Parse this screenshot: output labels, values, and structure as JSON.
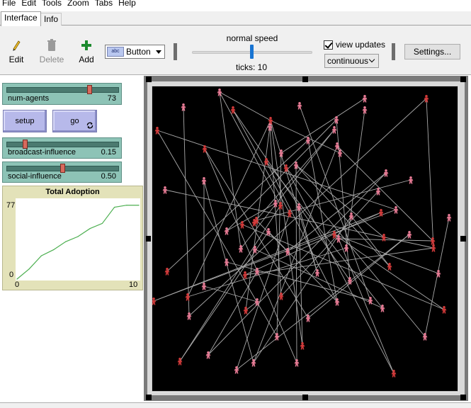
{
  "menu": [
    "File",
    "Edit",
    "Tools",
    "Zoom",
    "Tabs",
    "Help"
  ],
  "tabs": [
    {
      "label": "Interface",
      "active": true
    },
    {
      "label": "Info",
      "active": false
    }
  ],
  "toolbar": {
    "edit_label": "Edit",
    "delete_label": "Delete",
    "add_label": "Add",
    "widget_type": "Button",
    "widget_icon_text": "abc",
    "speed_label": "normal speed",
    "speed": 0.5,
    "ticks_text": "ticks: 10",
    "view_updates_label": "view updates",
    "view_updates_checked": true,
    "update_mode": "continuous",
    "settings_label": "Settings..."
  },
  "widgets": {
    "num_agents": {
      "label": "num-agents",
      "value": "73",
      "fraction": 0.75
    },
    "setup_label": "setup",
    "go_label": "go",
    "broadcast_influence": {
      "label": "broadcast-influence",
      "value": "0.15",
      "fraction": 0.15
    },
    "social_influence": {
      "label": "social-influence",
      "value": "0.50",
      "fraction": 0.5
    }
  },
  "chart_data": {
    "type": "line",
    "title": "Total Adoption",
    "xlabel": "",
    "ylabel": "",
    "xlim": [
      0,
      10
    ],
    "ylim": [
      0,
      77
    ],
    "x_tick_labels": [
      "0",
      "10"
    ],
    "y_tick_labels": [
      "0",
      "77"
    ],
    "series": [
      {
        "color": "#4caf50",
        "x": [
          0,
          1,
          2,
          3,
          4,
          5,
          6,
          7,
          8,
          9,
          10
        ],
        "y": [
          0,
          10,
          23,
          29,
          37,
          42,
          50,
          55,
          71,
          73,
          73
        ]
      }
    ]
  },
  "colors": {
    "slider_bg": "#8dc3b6",
    "button_bg": "#b7b9ea",
    "plot_bg": "#e3e2b9",
    "world_bg": "#000000",
    "adopter_color": "#d43a3a",
    "non_adopter_color": "#e87b95",
    "link_color": "#a9a9a9"
  },
  "agents": [
    {
      "x": 310,
      "y": 130,
      "s": 0
    },
    {
      "x": 259,
      "y": 151,
      "s": 0
    },
    {
      "x": 329,
      "y": 155,
      "s": 1
    },
    {
      "x": 423,
      "y": 149,
      "s": 0
    },
    {
      "x": 515,
      "y": 139,
      "s": 0
    },
    {
      "x": 515,
      "y": 155,
      "s": 0
    },
    {
      "x": 602,
      "y": 139,
      "s": 1
    },
    {
      "x": 382,
      "y": 170,
      "s": 1
    },
    {
      "x": 475,
      "y": 169,
      "s": 0
    },
    {
      "x": 222,
      "y": 184,
      "s": 1
    },
    {
      "x": 381,
      "y": 179,
      "s": 0
    },
    {
      "x": 472,
      "y": 183,
      "s": 0
    },
    {
      "x": 289,
      "y": 210,
      "s": 1
    },
    {
      "x": 435,
      "y": 198,
      "s": 0
    },
    {
      "x": 476,
      "y": 206,
      "s": 0
    },
    {
      "x": 397,
      "y": 216,
      "s": 0
    },
    {
      "x": 480,
      "y": 216,
      "s": 0
    },
    {
      "x": 376,
      "y": 228,
      "s": 1
    },
    {
      "x": 404,
      "y": 237,
      "s": 1
    },
    {
      "x": 418,
      "y": 233,
      "s": 0
    },
    {
      "x": 288,
      "y": 255,
      "s": 0
    },
    {
      "x": 545,
      "y": 244,
      "s": 0
    },
    {
      "x": 580,
      "y": 254,
      "s": 0
    },
    {
      "x": 233,
      "y": 268,
      "s": 0
    },
    {
      "x": 534,
      "y": 270,
      "s": 0
    },
    {
      "x": 389,
      "y": 287,
      "s": 0
    },
    {
      "x": 396,
      "y": 290,
      "s": 1
    },
    {
      "x": 422,
      "y": 292,
      "s": 0
    },
    {
      "x": 409,
      "y": 301,
      "s": 1
    },
    {
      "x": 559,
      "y": 296,
      "s": 0
    },
    {
      "x": 538,
      "y": 300,
      "s": 1
    },
    {
      "x": 496,
      "y": 305,
      "s": 0
    },
    {
      "x": 634,
      "y": 307,
      "s": 0
    },
    {
      "x": 359,
      "y": 314,
      "s": 1
    },
    {
      "x": 342,
      "y": 317,
      "s": 1
    },
    {
      "x": 362,
      "y": 311,
      "s": 1
    },
    {
      "x": 320,
      "y": 326,
      "s": 0
    },
    {
      "x": 379,
      "y": 327,
      "s": 0
    },
    {
      "x": 472,
      "y": 331,
      "s": 1
    },
    {
      "x": 478,
      "y": 337,
      "s": 0
    },
    {
      "x": 578,
      "y": 331,
      "s": 0
    },
    {
      "x": 542,
      "y": 335,
      "s": 1
    },
    {
      "x": 611,
      "y": 340,
      "s": 1
    },
    {
      "x": 612,
      "y": 350,
      "s": 1
    },
    {
      "x": 489,
      "y": 350,
      "s": 0
    },
    {
      "x": 340,
      "y": 351,
      "s": 0
    },
    {
      "x": 360,
      "y": 352,
      "s": 0
    },
    {
      "x": 406,
      "y": 355,
      "s": 0
    },
    {
      "x": 550,
      "y": 376,
      "s": 1
    },
    {
      "x": 320,
      "y": 370,
      "s": 0
    },
    {
      "x": 363,
      "y": 383,
      "s": 0
    },
    {
      "x": 236,
      "y": 383,
      "s": 1
    },
    {
      "x": 346,
      "y": 388,
      "s": 1
    },
    {
      "x": 448,
      "y": 385,
      "s": 0
    },
    {
      "x": 619,
      "y": 386,
      "s": 0
    },
    {
      "x": 288,
      "y": 404,
      "s": 0
    },
    {
      "x": 494,
      "y": 396,
      "s": 0
    },
    {
      "x": 265,
      "y": 419,
      "s": 1
    },
    {
      "x": 217,
      "y": 425,
      "s": 1
    },
    {
      "x": 363,
      "y": 426,
      "s": 0
    },
    {
      "x": 397,
      "y": 418,
      "s": 1
    },
    {
      "x": 476,
      "y": 426,
      "s": 0
    },
    {
      "x": 523,
      "y": 424,
      "s": 0
    },
    {
      "x": 540,
      "y": 435,
      "s": 0
    },
    {
      "x": 347,
      "y": 438,
      "s": 1
    },
    {
      "x": 627,
      "y": 437,
      "s": 1
    },
    {
      "x": 267,
      "y": 446,
      "s": 0
    },
    {
      "x": 435,
      "y": 449,
      "s": 0
    },
    {
      "x": 391,
      "y": 475,
      "s": 0
    },
    {
      "x": 600,
      "y": 475,
      "s": 0
    },
    {
      "x": 427,
      "y": 488,
      "s": 1
    },
    {
      "x": 294,
      "y": 501,
      "s": 0
    },
    {
      "x": 254,
      "y": 510,
      "s": 1
    },
    {
      "x": 334,
      "y": 522,
      "s": 0
    },
    {
      "x": 358,
      "y": 512,
      "s": 0
    },
    {
      "x": 419,
      "y": 512,
      "s": 0
    },
    {
      "x": 556,
      "y": 527,
      "s": 1
    }
  ],
  "links": [
    [
      0,
      7
    ],
    [
      0,
      26
    ],
    [
      0,
      45
    ],
    [
      2,
      28
    ],
    [
      3,
      62
    ],
    [
      4,
      15
    ],
    [
      5,
      44
    ],
    [
      6,
      66
    ],
    [
      6,
      43
    ],
    [
      7,
      16
    ],
    [
      7,
      53
    ],
    [
      7,
      70
    ],
    [
      7,
      57
    ],
    [
      8,
      56
    ],
    [
      9,
      29
    ],
    [
      10,
      64
    ],
    [
      11,
      45
    ],
    [
      11,
      33
    ],
    [
      13,
      51
    ],
    [
      14,
      42
    ],
    [
      15,
      68
    ],
    [
      17,
      63
    ],
    [
      18,
      76
    ],
    [
      19,
      75
    ],
    [
      19,
      41
    ],
    [
      20,
      74
    ],
    [
      20,
      55
    ],
    [
      21,
      71
    ],
    [
      22,
      35
    ],
    [
      24,
      60
    ],
    [
      25,
      36
    ],
    [
      26,
      72
    ],
    [
      27,
      53
    ],
    [
      28,
      73
    ],
    [
      29,
      58
    ],
    [
      30,
      52
    ],
    [
      31,
      48
    ],
    [
      32,
      69
    ],
    [
      34,
      65
    ],
    [
      35,
      47
    ],
    [
      37,
      61
    ],
    [
      38,
      54
    ],
    [
      39,
      42
    ],
    [
      40,
      67
    ],
    [
      43,
      23
    ],
    [
      44,
      57
    ],
    [
      46,
      63
    ],
    [
      49,
      62
    ],
    [
      50,
      71
    ],
    [
      52,
      43
    ],
    [
      55,
      59
    ],
    [
      58,
      30
    ],
    [
      59,
      64
    ],
    [
      60,
      10
    ],
    [
      61,
      17
    ],
    [
      65,
      38
    ],
    [
      66,
      1
    ],
    [
      67,
      12
    ],
    [
      68,
      9
    ],
    [
      69,
      18
    ],
    [
      70,
      27
    ],
    [
      72,
      37
    ],
    [
      73,
      40
    ],
    [
      74,
      14
    ],
    [
      75,
      12
    ],
    [
      76,
      39
    ],
    [
      8,
      36
    ],
    [
      13,
      61
    ],
    [
      21,
      47
    ],
    [
      31,
      74
    ],
    [
      48,
      19
    ],
    [
      56,
      2
    ]
  ]
}
